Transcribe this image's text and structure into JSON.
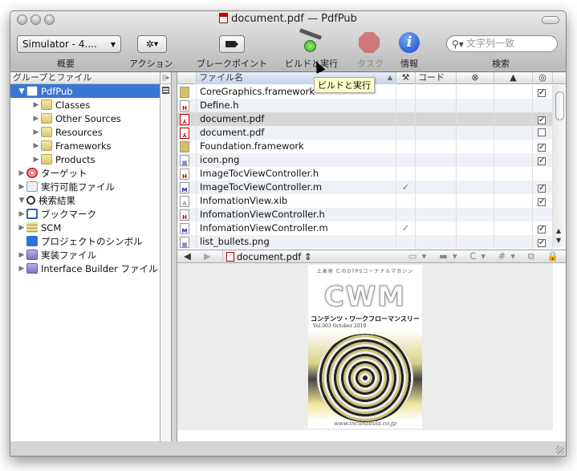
{
  "window": {
    "title": "document.pdf — PdfPub"
  },
  "toolbar": {
    "scheme": "Simulator - 4....",
    "overview_label": "概要",
    "action_label": "アクション",
    "breakpoint_label": "ブレークポイント",
    "build_label": "ビルドと実行",
    "task_label": "タスク",
    "info_label": "情報",
    "search_label": "検索",
    "search_placeholder": "文字列一致"
  },
  "tooltip": "ビルドと実行",
  "sidebar": {
    "header": "グループとファイル",
    "items": [
      {
        "label": "PdfPub",
        "icon": "project-icon",
        "expanded": true,
        "selected": true,
        "level": 0
      },
      {
        "label": "Classes",
        "icon": "folder-icon",
        "level": 1
      },
      {
        "label": "Other Sources",
        "icon": "folder-icon",
        "level": 1
      },
      {
        "label": "Resources",
        "icon": "folder-icon",
        "level": 1
      },
      {
        "label": "Frameworks",
        "icon": "folder-icon",
        "level": 1
      },
      {
        "label": "Products",
        "icon": "folder-icon",
        "level": 1
      },
      {
        "label": "ターゲット",
        "icon": "target-icon",
        "level": 0
      },
      {
        "label": "実行可能ファイル",
        "icon": "executable-icon",
        "level": 0
      },
      {
        "label": "検索結果",
        "icon": "search-icon",
        "expanded": true,
        "level": 0
      },
      {
        "label": "ブックマーク",
        "icon": "bookmark-icon",
        "level": 0
      },
      {
        "label": "SCM",
        "icon": "scm-icon",
        "level": 0
      },
      {
        "label": "プロジェクトのシンボル",
        "icon": "symbol-icon",
        "level": 0,
        "noexpand": true
      },
      {
        "label": "実装ファイル",
        "icon": "smart-folder-icon",
        "level": 0
      },
      {
        "label": "Interface Builder ファイル",
        "icon": "smart-folder-icon",
        "level": 0
      }
    ]
  },
  "filelist": {
    "columns": {
      "name": "ファイル名",
      "code": "コード"
    },
    "rows": [
      {
        "name": "CoreGraphics.framework",
        "type": "framework",
        "built": false,
        "target": "checked"
      },
      {
        "name": "Define.h",
        "type": "h",
        "built": false,
        "target": "none"
      },
      {
        "name": "document.pdf",
        "type": "pdf",
        "built": false,
        "target": "checked",
        "selected": true
      },
      {
        "name": "document.pdf",
        "type": "pdf",
        "built": false,
        "target": "unchecked"
      },
      {
        "name": "Foundation.framework",
        "type": "framework",
        "built": false,
        "target": "checked"
      },
      {
        "name": "icon.png",
        "type": "png",
        "built": false,
        "target": "checked"
      },
      {
        "name": "ImageTocViewController.h",
        "type": "h",
        "built": false,
        "target": "none"
      },
      {
        "name": "ImageTocViewController.m",
        "type": "m",
        "built": true,
        "target": "checked"
      },
      {
        "name": "InfomationView.xib",
        "type": "xib",
        "built": false,
        "target": "checked"
      },
      {
        "name": "InfomationViewController.h",
        "type": "h",
        "built": false,
        "target": "none"
      },
      {
        "name": "InfomationViewController.m",
        "type": "m",
        "built": true,
        "target": "checked"
      },
      {
        "name": "list_bullets.png",
        "type": "png",
        "built": false,
        "target": "checked"
      }
    ]
  },
  "editor": {
    "file": "document.pdf",
    "cover": {
      "tagline": "上高地 仁のDTPSコーナナルマガジン",
      "title": "CWM",
      "subtitle": "コンテンツ・ワークフローマンスリー",
      "issue": "Vol.003 October 2010",
      "url": "www.incunabula.co.jp"
    }
  }
}
